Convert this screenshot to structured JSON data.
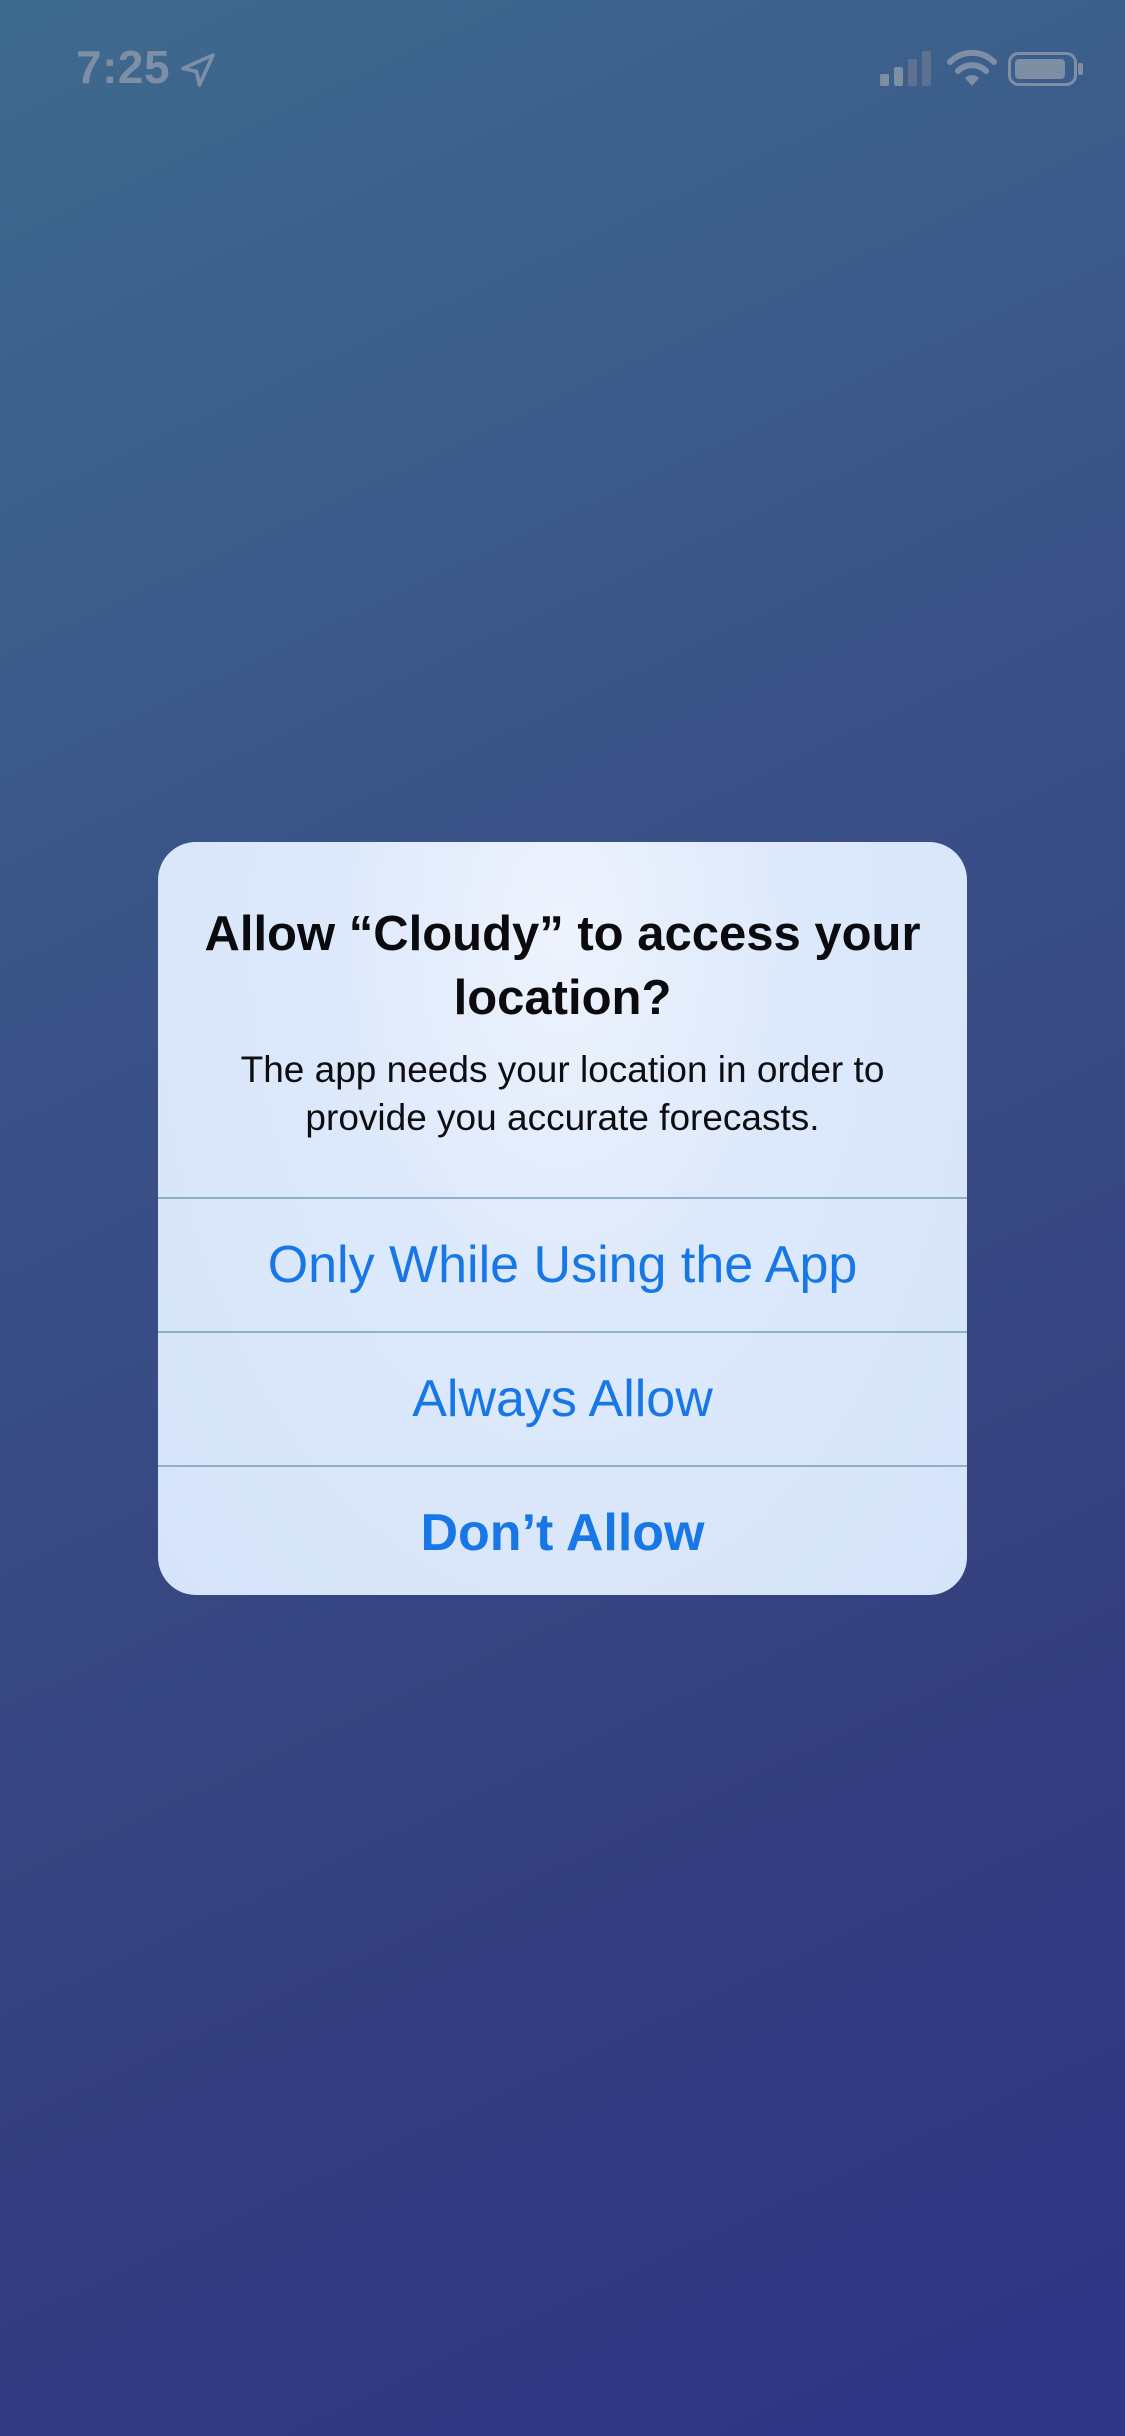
{
  "status_bar": {
    "time": "7:25",
    "icons": [
      "location-arrow-icon",
      "cellular-signal-icon",
      "wifi-icon",
      "battery-icon"
    ]
  },
  "alert": {
    "title": "Allow “Cloudy” to access your location?",
    "message": "The app needs your location in order to provide you accurate forecasts.",
    "buttons": [
      {
        "label": "Only While Using the App"
      },
      {
        "label": "Always Allow"
      },
      {
        "label": "Don’t Allow"
      }
    ]
  },
  "colors": {
    "accent": "#1877e6",
    "background_top": "#3e6a8e",
    "background_bottom": "#2f3486",
    "status_text": "#7d8ea5"
  }
}
